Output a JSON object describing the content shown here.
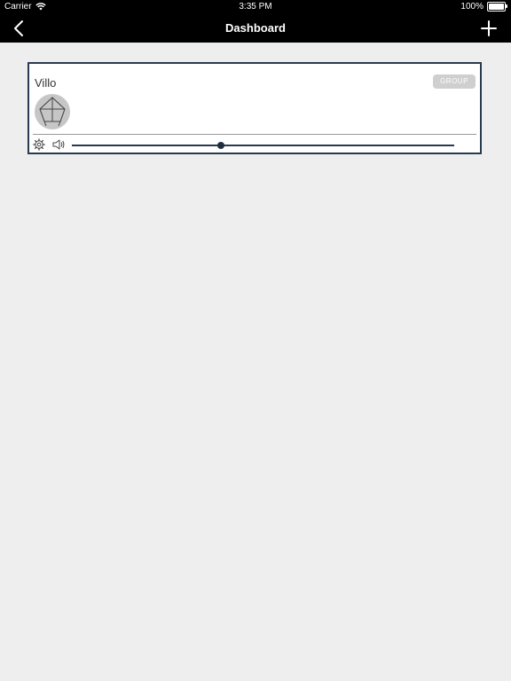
{
  "status_bar": {
    "carrier": "Carrier",
    "time": "3:35 PM",
    "battery": "100%"
  },
  "nav": {
    "title": "Dashboard",
    "back_icon": "chevron-left-icon",
    "add_icon": "plus-icon"
  },
  "card": {
    "title": "Villo",
    "badge": "GROUP",
    "avatar_icon": "speaker-device-icon",
    "settings_icon": "gear-icon",
    "volume_icon": "speaker-icon",
    "volume_level": 0.39
  },
  "colors": {
    "bar_background": "#000000",
    "page_background": "#eeeeee",
    "card_border": "#2a3a4e",
    "slider": "#1e2e40"
  }
}
